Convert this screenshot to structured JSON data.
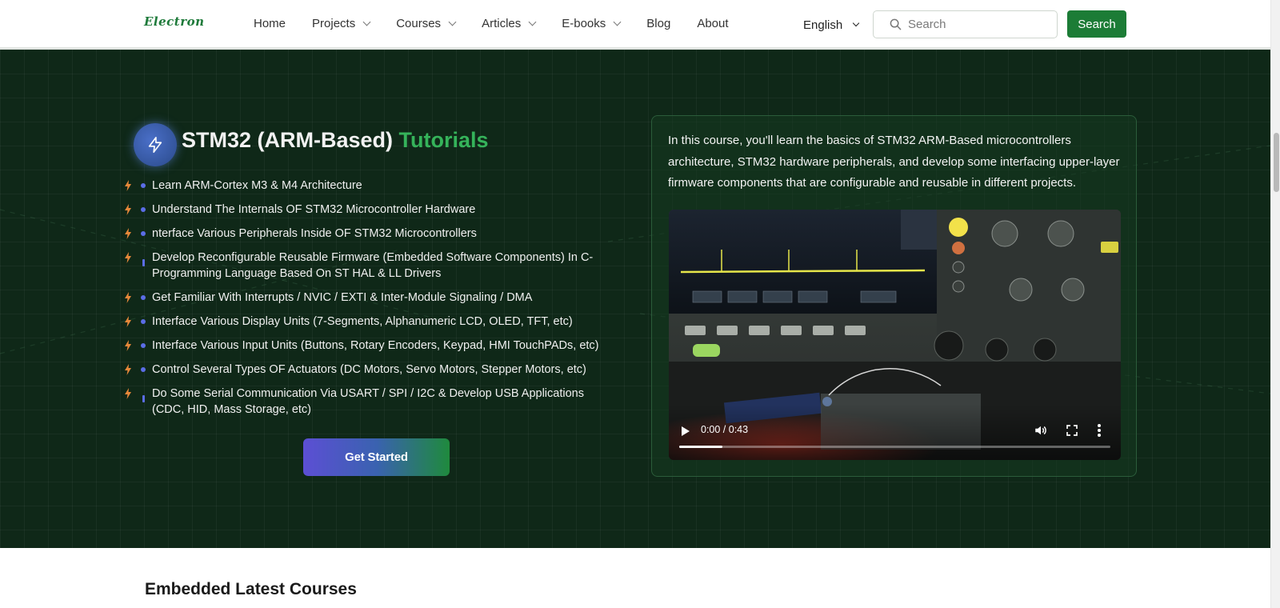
{
  "header": {
    "logo": "Electron",
    "nav": [
      {
        "label": "Home",
        "dropdown": false
      },
      {
        "label": "Projects",
        "dropdown": true
      },
      {
        "label": "Courses",
        "dropdown": true
      },
      {
        "label": "Articles",
        "dropdown": true
      },
      {
        "label": "E-books",
        "dropdown": true
      },
      {
        "label": "Blog",
        "dropdown": false
      },
      {
        "label": "About",
        "dropdown": false
      }
    ],
    "language": "English",
    "search_placeholder": "Search",
    "search_button": "Search"
  },
  "hero": {
    "title_main": "STM32 (ARM-Based)",
    "title_accent": "Tutorials",
    "features": [
      "Learn ARM-Cortex M3 & M4 Architecture",
      "Understand The Internals OF STM32 Microcontroller Hardware",
      "nterface Various Peripherals Inside OF STM32 Microcontrollers",
      "Develop Reconfigurable Reusable Firmware (Embedded Software Components) In C-Programming Language Based On ST HAL & LL Drivers",
      "Get Familiar With Interrupts / NVIC / EXTI & Inter-Module Signaling / DMA",
      "Interface Various Display Units (7-Segments, Alphanumeric LCD, OLED, TFT, etc)",
      "Interface Various Input Units (Buttons, Rotary Encoders, Keypad, HMI TouchPADs, etc)",
      "Control Several Types OF Actuators (DC Motors, Servo Motors, Stepper Motors, etc)",
      "Do Some Serial Communication Via USART / SPI / I2C & Develop USB Applications (CDC, HID, Mass Storage, etc)"
    ],
    "cta": "Get Started",
    "description": "In this course, you'll learn the basics of STM32 ARM-Based microcontrollers architecture, STM32 hardware peripherals, and develop some interfacing upper-layer firmware components that are configurable and reusable in different projects.",
    "video": {
      "time": "0:00 / 0:43",
      "progress_fraction": 0.1
    }
  },
  "section_title": "Embedded Latest Courses",
  "colors": {
    "brand_green": "#1c7c36",
    "accent_green": "#35b35a",
    "hero_bg": "#0f2818",
    "bullet_blue": "#5b6de6",
    "bolt_orange": "#e8883a"
  }
}
